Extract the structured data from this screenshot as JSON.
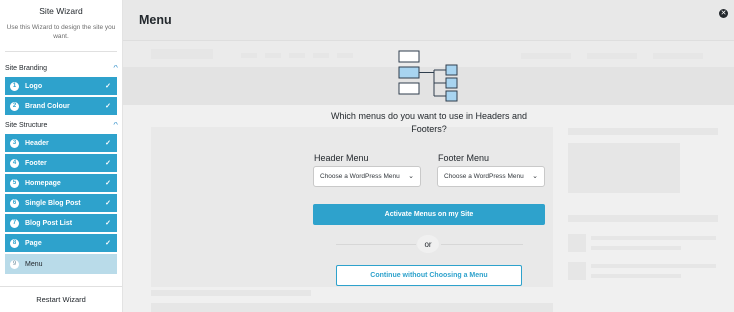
{
  "sidebar": {
    "title": "Site Wizard",
    "description": "Use this Wizard to design the site you want.",
    "sections": [
      {
        "label": "Site Branding",
        "steps": [
          {
            "num": "1",
            "label": "Logo",
            "done": "✓"
          },
          {
            "num": "2",
            "label": "Brand Colour",
            "done": "✓"
          }
        ]
      },
      {
        "label": "Site Structure",
        "steps": [
          {
            "num": "3",
            "label": "Header",
            "done": "✓"
          },
          {
            "num": "4",
            "label": "Footer",
            "done": "✓"
          },
          {
            "num": "5",
            "label": "Homepage",
            "done": "✓"
          },
          {
            "num": "6",
            "label": "Single Blog Post",
            "done": "✓"
          },
          {
            "num": "7",
            "label": "Blog Post List",
            "done": "✓"
          },
          {
            "num": "8",
            "label": "Page",
            "done": "✓"
          },
          {
            "num": "9",
            "label": "Menu",
            "done": ""
          }
        ]
      }
    ],
    "restart_label": "Restart Wizard"
  },
  "main": {
    "title": "Menu",
    "close_glyph": "✕",
    "question": "Which menus do you want to use in Headers and Footers?",
    "header_menu": {
      "label": "Header Menu",
      "value": "Choose a WordPress Menu"
    },
    "footer_menu": {
      "label": "Footer Menu",
      "value": "Choose a WordPress Menu"
    },
    "activate_label": "Activate Menus on my Site",
    "or_label": "or",
    "continue_label": "Continue without Choosing a Menu"
  },
  "icons": {
    "section_chevron": "chevron-up-icon",
    "menu_illustration": "menu-structure-icon",
    "select_caret": "chevron-down-icon"
  },
  "colors": {
    "accent": "#2ea2cc",
    "current_step": "#b9dbe9",
    "illustration_fill": "#a8d4f0",
    "illustration_stroke": "#2f3e4d"
  }
}
